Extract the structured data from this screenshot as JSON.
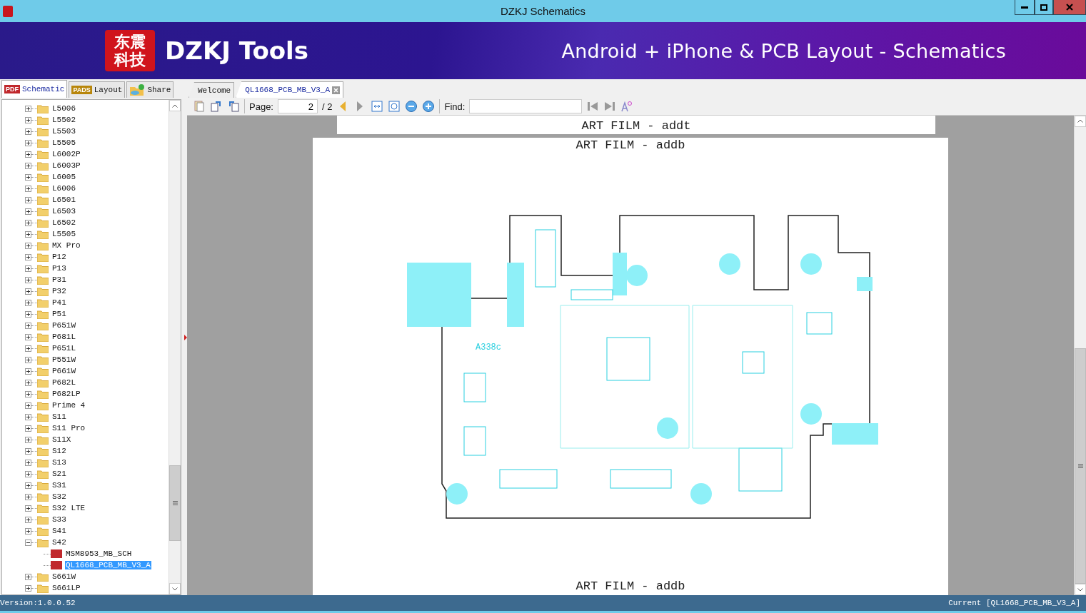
{
  "window": {
    "title": "DZKJ Schematics"
  },
  "banner": {
    "logo_text": "东震科技",
    "brand": "DZKJ Tools",
    "tagline": "Android + iPhone & PCB Layout - Schematics"
  },
  "side_tabs": [
    {
      "label": "Schematic",
      "badge": "PDF",
      "kind": "pdf",
      "selected": true
    },
    {
      "label": "Layout",
      "badge": "PADS",
      "kind": "pads",
      "selected": false
    },
    {
      "label": "Share",
      "kind": "share",
      "selected": false
    }
  ],
  "doc_tabs": [
    {
      "label": "Welcome",
      "selected": false,
      "closable": false
    },
    {
      "label": "QL1668_PCB_MB_V3_A",
      "selected": true,
      "closable": true
    }
  ],
  "toolbar": {
    "page_label": "Page:",
    "page_value": "2",
    "page_total": "/ 2",
    "find_label": "Find:"
  },
  "tree": [
    {
      "label": "L5006",
      "kind": "folder",
      "expanded": false,
      "selected": false
    },
    {
      "label": "L5502",
      "kind": "folder",
      "expanded": false,
      "selected": false
    },
    {
      "label": "L5503",
      "kind": "folder",
      "expanded": false,
      "selected": false
    },
    {
      "label": "L5505",
      "kind": "folder",
      "expanded": false,
      "selected": false
    },
    {
      "label": "L6002P",
      "kind": "folder",
      "expanded": false,
      "selected": false
    },
    {
      "label": "L6003P",
      "kind": "folder",
      "expanded": false,
      "selected": false
    },
    {
      "label": "L6005",
      "kind": "folder",
      "expanded": false,
      "selected": false
    },
    {
      "label": "L6006",
      "kind": "folder",
      "expanded": false,
      "selected": false
    },
    {
      "label": "L6501",
      "kind": "folder",
      "expanded": false,
      "selected": false
    },
    {
      "label": "L6503",
      "kind": "folder",
      "expanded": false,
      "selected": false
    },
    {
      "label": "L6502",
      "kind": "folder",
      "expanded": false,
      "selected": false
    },
    {
      "label": "L5505",
      "kind": "folder",
      "expanded": false,
      "selected": false
    },
    {
      "label": "MX Pro",
      "kind": "folder",
      "expanded": false,
      "selected": false
    },
    {
      "label": "P12",
      "kind": "folder",
      "expanded": false,
      "selected": false
    },
    {
      "label": "P13",
      "kind": "folder",
      "expanded": false,
      "selected": false
    },
    {
      "label": "P31",
      "kind": "folder",
      "expanded": false,
      "selected": false
    },
    {
      "label": "P32",
      "kind": "folder",
      "expanded": false,
      "selected": false
    },
    {
      "label": "P41",
      "kind": "folder",
      "expanded": false,
      "selected": false
    },
    {
      "label": "P51",
      "kind": "folder",
      "expanded": false,
      "selected": false
    },
    {
      "label": "P651W",
      "kind": "folder",
      "expanded": false,
      "selected": false
    },
    {
      "label": "P681L",
      "kind": "folder",
      "expanded": false,
      "selected": false
    },
    {
      "label": "P651L",
      "kind": "folder",
      "expanded": false,
      "selected": false
    },
    {
      "label": "P551W",
      "kind": "folder",
      "expanded": false,
      "selected": false
    },
    {
      "label": "P661W",
      "kind": "folder",
      "expanded": false,
      "selected": false
    },
    {
      "label": "P682L",
      "kind": "folder",
      "expanded": false,
      "selected": false
    },
    {
      "label": "P682LP",
      "kind": "folder",
      "expanded": false,
      "selected": false
    },
    {
      "label": "Prime 4",
      "kind": "folder",
      "expanded": false,
      "selected": false
    },
    {
      "label": "S11",
      "kind": "folder",
      "expanded": false,
      "selected": false
    },
    {
      "label": "S11 Pro",
      "kind": "folder",
      "expanded": false,
      "selected": false
    },
    {
      "label": "S11X",
      "kind": "folder",
      "expanded": false,
      "selected": false
    },
    {
      "label": "S12",
      "kind": "folder",
      "expanded": false,
      "selected": false
    },
    {
      "label": "S13",
      "kind": "folder",
      "expanded": false,
      "selected": false
    },
    {
      "label": "S21",
      "kind": "folder",
      "expanded": false,
      "selected": false
    },
    {
      "label": "S31",
      "kind": "folder",
      "expanded": false,
      "selected": false
    },
    {
      "label": "S32",
      "kind": "folder",
      "expanded": false,
      "selected": false
    },
    {
      "label": "S32 LTE",
      "kind": "folder",
      "expanded": false,
      "selected": false
    },
    {
      "label": "S33",
      "kind": "folder",
      "expanded": false,
      "selected": false
    },
    {
      "label": "S41",
      "kind": "folder",
      "expanded": false,
      "selected": false
    },
    {
      "label": "S42",
      "kind": "folder",
      "expanded": true,
      "selected": false,
      "children": [
        {
          "label": "MSM8953_MB_SCH",
          "kind": "pdf",
          "selected": false
        },
        {
          "label": "QL1668_PCB_MB_V3_A",
          "kind": "pdf",
          "selected": true
        }
      ]
    },
    {
      "label": "S661W",
      "kind": "folder",
      "expanded": false,
      "selected": false
    },
    {
      "label": "S661LP",
      "kind": "folder",
      "expanded": false,
      "selected": false
    }
  ],
  "document": {
    "pages": [
      {
        "captions": [
          "ART FILM - addt"
        ]
      },
      {
        "captions": [
          "ART FILM - addb",
          "ART FILM - addb"
        ],
        "board_label": "A338c"
      }
    ]
  },
  "status_bar": {
    "version": "Version:1.0.0.52",
    "current": "Current [QL1668_PCB_MB_V3_A]"
  }
}
